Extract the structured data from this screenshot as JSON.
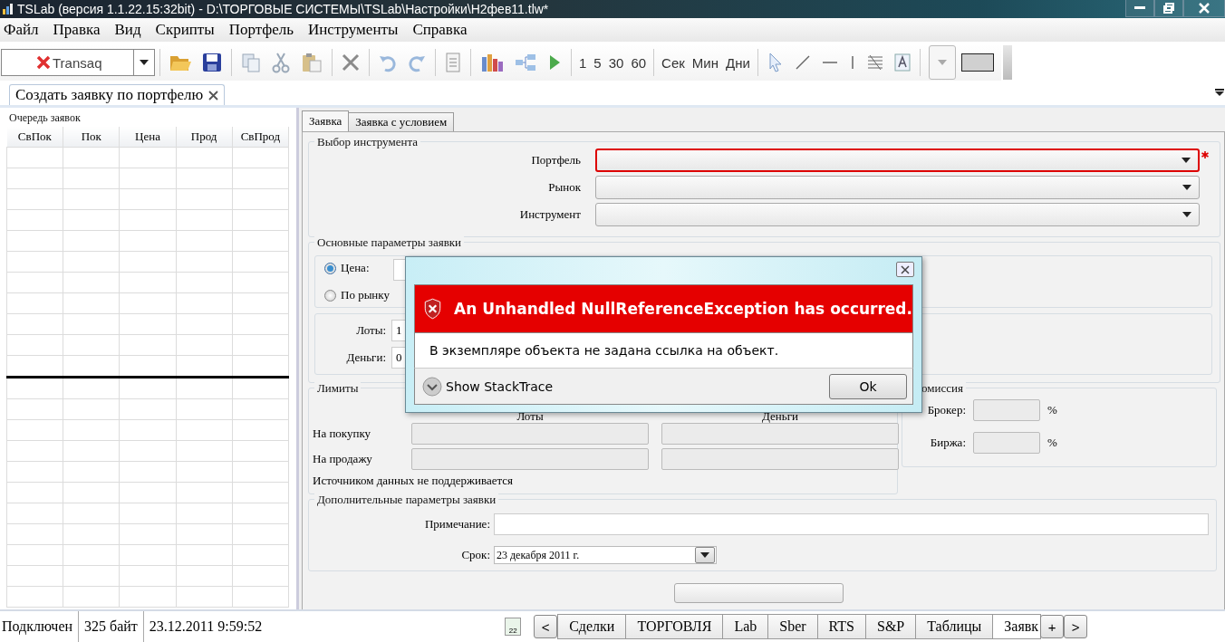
{
  "window": {
    "title": "TSLab (версия 1.1.22.15:32bit) - D:\\ТОРГОВЫЕ СИСТЕМЫ\\TSLab\\Настройки\\H2фев11.tlw*"
  },
  "menu": [
    "Файл",
    "Правка",
    "Вид",
    "Скрипты",
    "Портфель",
    "Инструменты",
    "Справка"
  ],
  "toolbar": {
    "connector": "Transaq",
    "intervals": [
      "1",
      "5",
      "30",
      "60"
    ],
    "units": [
      "Сек",
      "Мин",
      "Дни"
    ]
  },
  "doc_tabs": [
    {
      "label": "Создать заявку по портфелю",
      "selected": true
    }
  ],
  "order_queue": {
    "title": "Очередь заявок",
    "columns": [
      "СвПок",
      "Пок",
      "Цена",
      "Прод",
      "СвПрод"
    ]
  },
  "form_tabs": [
    {
      "label": "Заявка",
      "selected": true
    },
    {
      "label": "Заявка с условием",
      "selected": false
    }
  ],
  "instrument": {
    "title": "Выбор инструмента",
    "fields": [
      {
        "label": "Портфель",
        "required": true
      },
      {
        "label": "Рынок",
        "required": false
      },
      {
        "label": "Инструмент",
        "required": false
      }
    ]
  },
  "main_params": {
    "title": "Основные параметры заявки",
    "price_modes": [
      {
        "label": "Цена:",
        "selected": true
      },
      {
        "label": "По рынку",
        "selected": false
      }
    ],
    "lots": {
      "label": "Лоты:",
      "value": "1"
    },
    "money": {
      "label": "Деньги:",
      "value": "0"
    }
  },
  "limits": {
    "title": "Лимиты",
    "columns": [
      "Лоты",
      "Деньги"
    ],
    "rows": [
      "На покупку",
      "На продажу"
    ],
    "note": "Источником данных не поддерживается"
  },
  "commission": {
    "title": "омиссия",
    "fields": [
      {
        "label": "Брокер:",
        "unit": "%"
      },
      {
        "label": "Биржа:",
        "unit": "%"
      }
    ]
  },
  "extra": {
    "title": "Дополнительные параметры заявки",
    "note_label": "Примечание:",
    "term_label": "Срок:",
    "term_value": "23 декабря 2011 г."
  },
  "dialog": {
    "heading": "An Unhandled NullReferenceException has occurred.",
    "message": "В экземпляре объекта не задана ссылка на объект.",
    "stack_trace": "Show StackTrace",
    "ok": "Ok"
  },
  "status_bar": {
    "connection": "Подключен",
    "traffic": "325 байт",
    "time": "23.12.2011 9:59:52",
    "calendar_day": "22"
  },
  "bottom_tabs": {
    "prev": "<",
    "tabs": [
      {
        "label": "Сделки",
        "selected": false
      },
      {
        "label": "ТОРГОВЛЯ",
        "selected": false
      },
      {
        "label": "Lab",
        "selected": false
      },
      {
        "label": "Sber",
        "selected": false
      },
      {
        "label": "RTS",
        "selected": false
      },
      {
        "label": "S&P",
        "selected": false
      },
      {
        "label": "Таблицы",
        "selected": false
      },
      {
        "label": "Заявк",
        "selected": true
      }
    ],
    "add": "+",
    "next": ">"
  }
}
